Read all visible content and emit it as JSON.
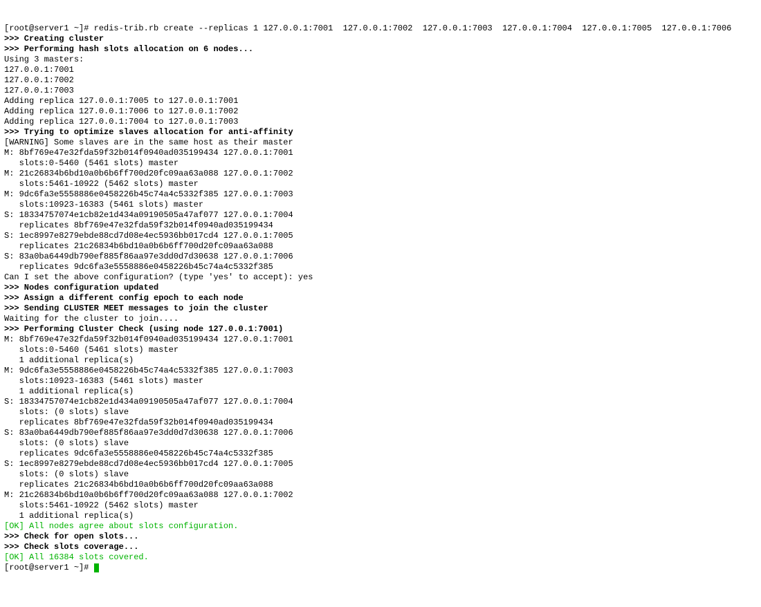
{
  "prompt1": "[root@server1 ~]# redis-trib.rb create --replicas 1 127.0.0.1:7001  127.0.0.1:7002  127.0.0.1:7003  127.0.0.1:7004  127.0.0.1:7005  127.0.0.1:7006",
  "l1": ">>> Creating cluster",
  "l2": ">>> Performing hash slots allocation on 6 nodes...",
  "l3": "Using 3 masters:",
  "l4": "127.0.0.1:7001",
  "l5": "127.0.0.1:7002",
  "l6": "127.0.0.1:7003",
  "l7": "Adding replica 127.0.0.1:7005 to 127.0.0.1:7001",
  "l8": "Adding replica 127.0.0.1:7006 to 127.0.0.1:7002",
  "l9": "Adding replica 127.0.0.1:7004 to 127.0.0.1:7003",
  "l10": ">>> Trying to optimize slaves allocation for anti-affinity",
  "l11": "[WARNING] Some slaves are in the same host as their master",
  "l12": "M: 8bf769e47e32fda59f32b014f0940ad035199434 127.0.0.1:7001",
  "l13": "   slots:0-5460 (5461 slots) master",
  "l14": "M: 21c26834b6bd10a0b6b6ff700d20fc09aa63a088 127.0.0.1:7002",
  "l15": "   slots:5461-10922 (5462 slots) master",
  "l16": "M: 9dc6fa3e5558886e0458226b45c74a4c5332f385 127.0.0.1:7003",
  "l17": "   slots:10923-16383 (5461 slots) master",
  "l18": "S: 18334757074e1cb82e1d434a09190505a47af077 127.0.0.1:7004",
  "l19": "   replicates 8bf769e47e32fda59f32b014f0940ad035199434",
  "l20": "S: 1ec8997e8279ebde88cd7d08e4ec5936bb017cd4 127.0.0.1:7005",
  "l21": "   replicates 21c26834b6bd10a0b6b6ff700d20fc09aa63a088",
  "l22": "S: 83a0ba6449db790ef885f86aa97e3dd0d7d30638 127.0.0.1:7006",
  "l23": "   replicates 9dc6fa3e5558886e0458226b45c74a4c5332f385",
  "l24": "Can I set the above configuration? (type 'yes' to accept): yes",
  "l25": ">>> Nodes configuration updated",
  "l26": ">>> Assign a different config epoch to each node",
  "l27": ">>> Sending CLUSTER MEET messages to join the cluster",
  "l28": "Waiting for the cluster to join....",
  "l29": ">>> Performing Cluster Check (using node 127.0.0.1:7001)",
  "l30": "M: 8bf769e47e32fda59f32b014f0940ad035199434 127.0.0.1:7001",
  "l31": "   slots:0-5460 (5461 slots) master",
  "l32": "   1 additional replica(s)",
  "l33": "M: 9dc6fa3e5558886e0458226b45c74a4c5332f385 127.0.0.1:7003",
  "l34": "   slots:10923-16383 (5461 slots) master",
  "l35": "   1 additional replica(s)",
  "l36": "S: 18334757074e1cb82e1d434a09190505a47af077 127.0.0.1:7004",
  "l37": "   slots: (0 slots) slave",
  "l38": "   replicates 8bf769e47e32fda59f32b014f0940ad035199434",
  "l39": "S: 83a0ba6449db790ef885f86aa97e3dd0d7d30638 127.0.0.1:7006",
  "l40": "   slots: (0 slots) slave",
  "l41": "   replicates 9dc6fa3e5558886e0458226b45c74a4c5332f385",
  "l42": "S: 1ec8997e8279ebde88cd7d08e4ec5936bb017cd4 127.0.0.1:7005",
  "l43": "   slots: (0 slots) slave",
  "l44": "   replicates 21c26834b6bd10a0b6b6ff700d20fc09aa63a088",
  "l45": "M: 21c26834b6bd10a0b6b6ff700d20fc09aa63a088 127.0.0.1:7002",
  "l46": "   slots:5461-10922 (5462 slots) master",
  "l47": "   1 additional replica(s)",
  "l48": "[OK] All nodes agree about slots configuration.",
  "l49": ">>> Check for open slots...",
  "l50": ">>> Check slots coverage...",
  "l51": "[OK] All 16384 slots covered.",
  "prompt2": "[root@server1 ~]# "
}
